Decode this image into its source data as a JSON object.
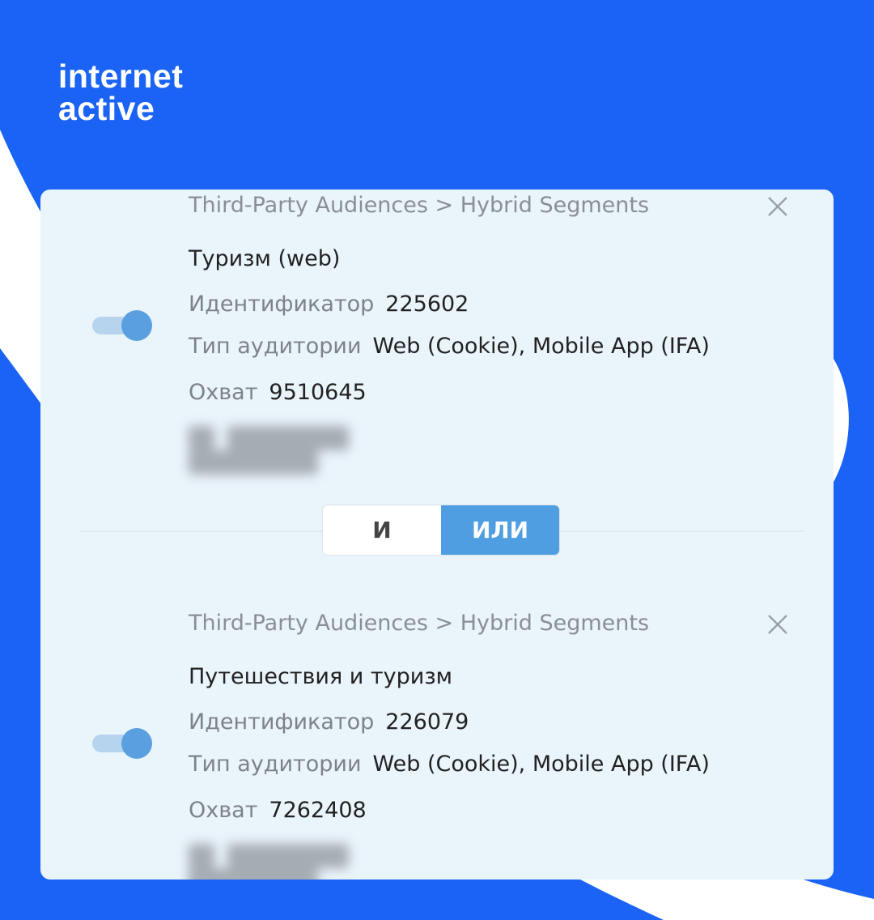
{
  "brand": {
    "logo_line1": "internet",
    "logo_line2": "active",
    "background_color": "#1a63f5",
    "accent_dot_color": "#ff5a1f"
  },
  "segments": [
    {
      "breadcrumb": "Third-Party Audiences > Hybrid Segments",
      "title": "Туризм (web)",
      "id_label": "Идентификатор",
      "id_value": "225602",
      "type_label": "Тип аудитории",
      "type_value": "Web (Cookie), Mobile App (IFA)",
      "reach_label": "Охват",
      "reach_value": "9510645",
      "enabled": true
    },
    {
      "breadcrumb": "Third-Party Audiences > Hybrid Segments",
      "title": "Путешествия и туризм",
      "id_label": "Идентификатор",
      "id_value": "226079",
      "type_label": "Тип аудитории",
      "type_value": "Web (Cookie), Mobile App (IFA)",
      "reach_label": "Охват",
      "reach_value": "7262408",
      "enabled": true
    }
  ],
  "logic_switch": {
    "and_label": "И",
    "or_label": "ИЛИ",
    "selected": "ИЛИ"
  },
  "colors": {
    "toggle_on": "#5a9fe0",
    "selected_button": "#4f9ee2",
    "card_background": "#eaf4fb"
  }
}
